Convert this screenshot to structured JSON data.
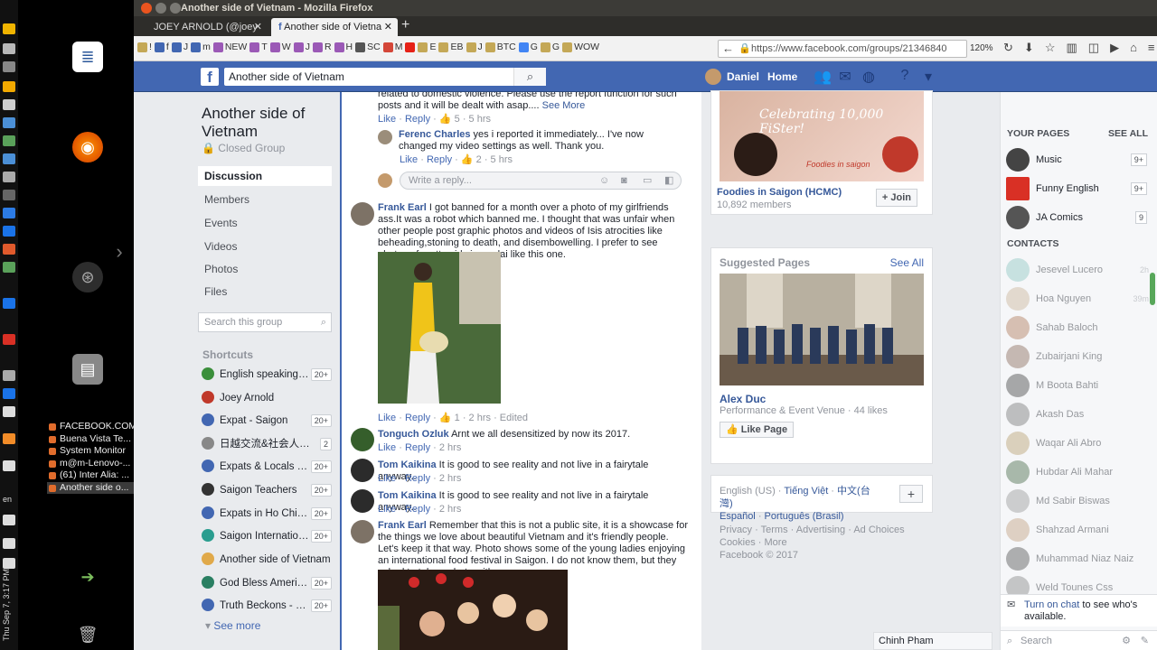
{
  "window": {
    "title": "Another side of Vietnam - Mozilla Firefox",
    "tabs": [
      {
        "label": "JOEY ARNOLD (@joey"
      },
      {
        "label": "Another side of Vietna"
      }
    ],
    "url": "https://www.facebook.com/groups/21346840",
    "zoom": "120%"
  },
  "bookmarks": [
    "!",
    "f",
    "J",
    "m",
    "NEW",
    "T",
    "W",
    "J",
    "R",
    "H",
    "SC",
    "M",
    "E",
    "EB",
    "J",
    "BTC",
    "G",
    "G",
    "WOW"
  ],
  "taskbar": {
    "items": [
      "FACEBOOK.COM",
      "Buena Vista Te...",
      "System Monitor",
      "m@m-Lenovo-...",
      "(61) Inter Alia: ...",
      "Another side o..."
    ],
    "clock": "Thu Sep 7, 3:17 PM",
    "lang": "en"
  },
  "fb": {
    "search_value": "Another side of Vietnam",
    "user_name": "Daniel",
    "home_label": "Home"
  },
  "group": {
    "title": "Another side of Vietnam",
    "privacy": "Closed Group",
    "nav": [
      "Discussion",
      "Members",
      "Events",
      "Videos",
      "Photos",
      "Files"
    ],
    "search_placeholder": "Search this group",
    "shortcuts_heading": "Shortcuts",
    "shortcuts": [
      {
        "label": "English speaking g...",
        "badge": "20+",
        "color": "#3b8f3b"
      },
      {
        "label": "Joey Arnold",
        "badge": "",
        "color": "#c0392b"
      },
      {
        "label": "Expat - Saigon",
        "badge": "20+",
        "color": "#4267b2"
      },
      {
        "label": "日越交流&社会人ボ...",
        "badge": "2",
        "color": "#888888"
      },
      {
        "label": "Expats & Locals In ...",
        "badge": "20+",
        "color": "#4267b2"
      },
      {
        "label": "Saigon Teachers",
        "badge": "20+",
        "color": "#333333"
      },
      {
        "label": "Expats in Ho Chi Mi...",
        "badge": "20+",
        "color": "#4267b2"
      },
      {
        "label": "Saigon Internation...",
        "badge": "20+",
        "color": "#2a9d8f"
      },
      {
        "label": "Another side of Vietnam",
        "badge": "",
        "color": "#e0a94a"
      },
      {
        "label": "God Bless America...",
        "badge": "20+",
        "color": "#2a7f62"
      },
      {
        "label": "Truth Beckons - No...",
        "badge": "20+",
        "color": "#4267b2"
      }
    ],
    "see_more": "See more"
  },
  "feed": {
    "top_fragment": "related to domestic violence. Please use the report function for such posts and it will be dealt with asap....",
    "see_more": "See More",
    "top_meta": {
      "like": "Like",
      "reply": "Reply",
      "count": "5",
      "time": "5 hrs"
    },
    "ferenc": {
      "name": "Ferenc Charles",
      "text": "yes i reported it immediately... I've now changed my video settings as well. Thank you.",
      "like": "Like",
      "reply": "Reply",
      "count": "2",
      "time": "5 hrs"
    },
    "reply_placeholder": "Write a reply...",
    "comments": [
      {
        "name": "Frank Earl",
        "text": "I got banned for a month over a photo of my girlfriends ass.It was a robot which banned me. I thought that was unfair when other people post graphic photos and videos of Isis atrocities like beheading,stoning to death, and disembowelling. I prefer to see photos of pretty girls in ao dai like this one.",
        "like": "Like",
        "reply": "Reply",
        "count": "1",
        "time": "2 hrs",
        "edited": "Edited"
      },
      {
        "name": "Tonguch Ozluk",
        "text": "Arnt we all desensitized by now its 2017.",
        "like": "Like",
        "reply": "Reply",
        "time": "2 hrs"
      },
      {
        "name": "Tom Kaikina",
        "text": "It is good to see reality and not live in a fairytale anyway..",
        "like": "Like",
        "reply": "Reply",
        "time": "2 hrs"
      },
      {
        "name": "Tom Kaikina",
        "text": "It is good to see reality and not live in a fairytale anyway..",
        "like": "Like",
        "reply": "Reply",
        "time": "2 hrs"
      },
      {
        "name": "Frank Earl",
        "text": "Remember that this is not a public site, it is a showcase for the things we love about beautiful Vietnam and it's friendly people. Let's keep it that way. Photo shows some of the young ladies enjoying an international food festival in Saigon. I do not know them, but they asked to take a photo with me."
      }
    ]
  },
  "right": {
    "banner_text": "Celebrating 10,000 FiSter!",
    "banner_brand": "Foodies in saigon",
    "suggest_group": {
      "name": "Foodies in Saigon (HCMC)",
      "members": "10,892 members",
      "join": "Join"
    },
    "suggested_heading": "Suggested Pages",
    "see_all": "See All",
    "page": {
      "name": "Alex Duc",
      "category": "Performance & Event Venue · 44 likes",
      "like_btn": "Like Page"
    },
    "languages": [
      "English (US)",
      "Tiếng Việt",
      "中文(台灣)",
      "Español",
      "Português (Brasil)"
    ],
    "footer_lines": [
      "Privacy · Terms · Advertising · Ad Choices",
      "Cookies · More",
      "Facebook © 2017"
    ],
    "chat_tab": "Chinh Pham"
  },
  "chat": {
    "your_pages": "YOUR PAGES",
    "see_all": "SEE ALL",
    "pages": [
      {
        "name": "Music",
        "badge": "9+",
        "color": "#444444"
      },
      {
        "name": "Funny English",
        "badge": "9+",
        "color": "#d93025"
      },
      {
        "name": "JA Comics",
        "badge": "9",
        "color": "#555555"
      }
    ],
    "contacts_heading": "CONTACTS",
    "contacts": [
      {
        "name": "Jesevel Lucero",
        "time": "2h"
      },
      {
        "name": "Hoa Nguyen",
        "time": "39m"
      },
      {
        "name": "Sahab Baloch",
        "time": ""
      },
      {
        "name": "Zubairjani King",
        "time": ""
      },
      {
        "name": "M Boota Bahti",
        "time": ""
      },
      {
        "name": "Akash Das",
        "time": ""
      },
      {
        "name": "Waqar Ali Abro",
        "time": ""
      },
      {
        "name": "Hubdar Ali Mahar",
        "time": ""
      },
      {
        "name": "Md Sabir Biswas",
        "time": ""
      },
      {
        "name": "Shahzad Armani",
        "time": ""
      },
      {
        "name": "Muhammad Niaz Naiz",
        "time": ""
      },
      {
        "name": "Weld Tounes Css",
        "time": ""
      }
    ],
    "turn_on_chat": "Turn on chat",
    "turn_on_rest": "to see who's available.",
    "search_placeholder": "Search"
  }
}
